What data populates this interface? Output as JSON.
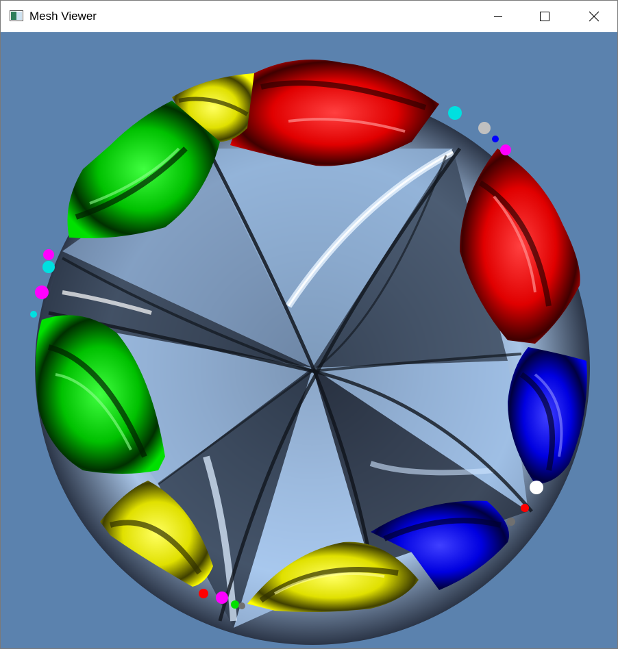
{
  "window": {
    "title": "Mesh Viewer",
    "controls": {
      "minimize": "minimize",
      "maximize": "maximize",
      "close": "close"
    }
  },
  "viewport": {
    "background": "#5b82ae",
    "mesh_colors": {
      "center_light": "#b8d8ff",
      "center_dark": "#1c2230",
      "red": "#ff0000",
      "green": "#00e000",
      "blue": "#0000ff",
      "yellow": "#ffff00",
      "cyan": "#00e0e0",
      "magenta": "#ff00ff",
      "white": "#ffffff"
    }
  }
}
